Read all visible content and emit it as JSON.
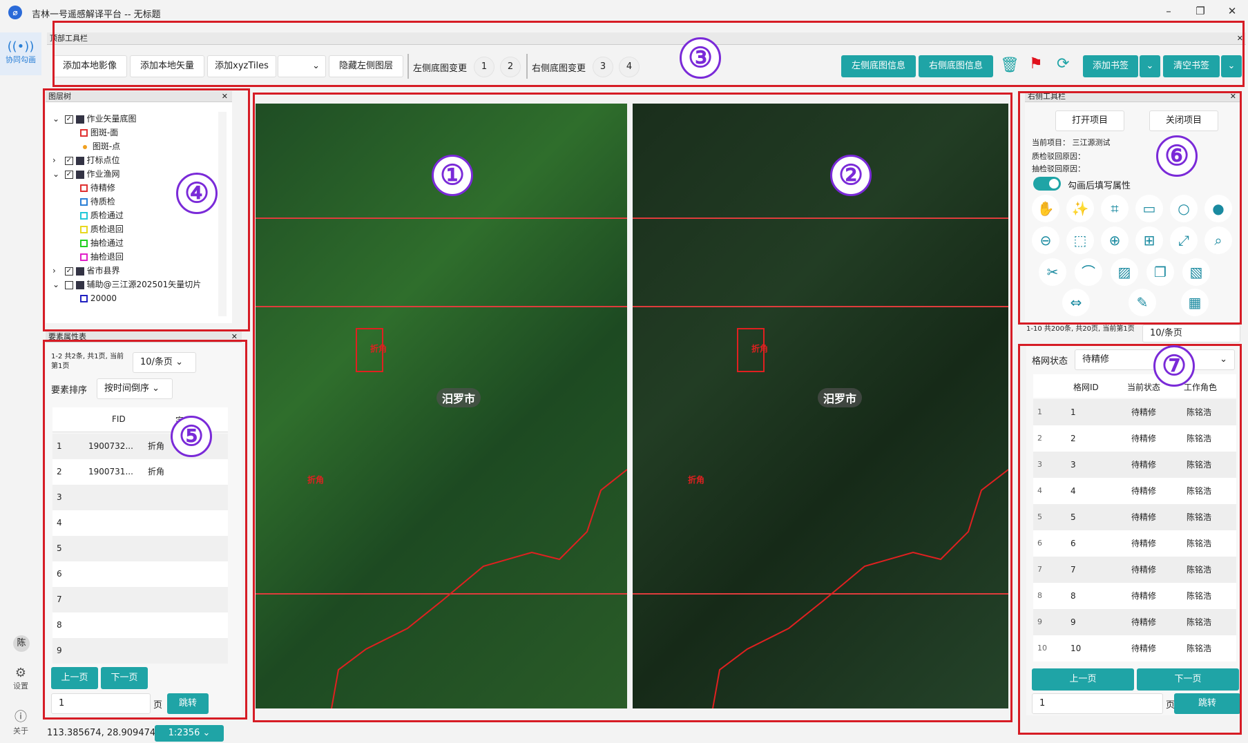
{
  "app": {
    "title": "吉林一号遥感解译平台 -- 无标题",
    "logo_icon": "app-logo-icon"
  },
  "window": {
    "minimize": "–",
    "maximize": "❐",
    "close": "✕"
  },
  "nav": {
    "collab": "协同勾画",
    "settings": "设置",
    "about": "关于",
    "avatar": "陈"
  },
  "toolbar": {
    "header": "顶部工具栏",
    "close": "✕",
    "add_image": "添加本地影像",
    "add_vector": "添加本地矢量",
    "add_xyz": "添加xyzTiles",
    "hide_left": "隐藏左侧图层",
    "left_change": "左侧底图变更",
    "n1": "1",
    "n2": "2",
    "right_change": "右侧底图变更",
    "n3": "3",
    "n4": "4",
    "left_info": "左侧底图信息",
    "right_info": "右侧底图信息",
    "add_bookmark": "添加书签",
    "clear_bookmark": "清空书签"
  },
  "layer_tree": {
    "header": "图层树",
    "close": "✕",
    "items": [
      {
        "label": "作业矢量底图",
        "level": 0
      },
      {
        "label": "图斑-面",
        "level": 1
      },
      {
        "label": "图斑-点",
        "level": 1
      },
      {
        "label": "打标点位",
        "level": 0
      },
      {
        "label": "作业渔网",
        "level": 0
      },
      {
        "label": "待精修",
        "level": 1
      },
      {
        "label": "待质检",
        "level": 1
      },
      {
        "label": "质检通过",
        "level": 1
      },
      {
        "label": "质检退回",
        "level": 1
      },
      {
        "label": "抽检通过",
        "level": 1
      },
      {
        "label": "抽检退回",
        "level": 1
      },
      {
        "label": "省市县界",
        "level": 0
      },
      {
        "label": "辅助@三江源202501矢量切片",
        "level": 0
      },
      {
        "label": "20000",
        "level": 1
      }
    ],
    "colors": {
      "red": "#e03030",
      "orange": "#f0a020",
      "blue": "#2a7fd6",
      "cyan": "#20c8d8",
      "yellow": "#e8d820",
      "green": "#20d020",
      "magenta": "#e020c8",
      "navy": "#2020c0"
    }
  },
  "attr_table": {
    "header": "要素属性表",
    "close": "✕",
    "pageinfo": "1-2 共2条, 共1页, 当前第1页",
    "per_page": "10/条页",
    "sort_label": "要素排序",
    "sort_value": "按时间倒序",
    "col_fid": "FID",
    "col_field": "字段1",
    "rows": [
      {
        "n": "1",
        "fid": "1900732...",
        "f": "折角"
      },
      {
        "n": "2",
        "fid": "1900731...",
        "f": "折角"
      },
      {
        "n": "3",
        "fid": "",
        "f": ""
      },
      {
        "n": "4",
        "fid": "",
        "f": ""
      },
      {
        "n": "5",
        "fid": "",
        "f": ""
      },
      {
        "n": "6",
        "fid": "",
        "f": ""
      },
      {
        "n": "7",
        "fid": "",
        "f": ""
      },
      {
        "n": "8",
        "fid": "",
        "f": ""
      },
      {
        "n": "9",
        "fid": "",
        "f": ""
      }
    ],
    "prev": "上一页",
    "next": "下一页",
    "page_input": "1",
    "page_unit": "页",
    "jump": "跳转"
  },
  "status": {
    "coords": "113.385674, 28.909474",
    "scale": "1:2356"
  },
  "maps": {
    "left_label": "汨罗市",
    "right_label": "汨罗市",
    "marker": "折角"
  },
  "right_tools": {
    "header": "右侧工具栏",
    "close": "✕",
    "open_project": "打开项目",
    "close_project": "关闭项目",
    "current_project": "当前项目：  三江源测试",
    "qc_reason": "质检驳回原因：",
    "sample_reason": "抽检驳回原因：",
    "toggle_label": "勾画后填写属性"
  },
  "grid_table": {
    "pageinfo": "1-10 共200条, 共20页, 当前第1页",
    "per_page": "10/条页",
    "status_label": "格网状态",
    "status_value": "待精修",
    "col_id": "格网ID",
    "col_state": "当前状态",
    "col_role": "工作角色",
    "rows": [
      {
        "n": "1",
        "id": "1",
        "state": "待精修",
        "role": "陈铭浩"
      },
      {
        "n": "2",
        "id": "2",
        "state": "待精修",
        "role": "陈铭浩"
      },
      {
        "n": "3",
        "id": "3",
        "state": "待精修",
        "role": "陈铭浩"
      },
      {
        "n": "4",
        "id": "4",
        "state": "待精修",
        "role": "陈铭浩"
      },
      {
        "n": "5",
        "id": "5",
        "state": "待精修",
        "role": "陈铭浩"
      },
      {
        "n": "6",
        "id": "6",
        "state": "待精修",
        "role": "陈铭浩"
      },
      {
        "n": "7",
        "id": "7",
        "state": "待精修",
        "role": "陈铭浩"
      },
      {
        "n": "8",
        "id": "8",
        "state": "待精修",
        "role": "陈铭浩"
      },
      {
        "n": "9",
        "id": "9",
        "state": "待精修",
        "role": "陈铭浩"
      },
      {
        "n": "10",
        "id": "10",
        "state": "待精修",
        "role": "陈铭浩"
      }
    ],
    "prev": "上一页",
    "next": "下一页",
    "page_input": "1",
    "page_unit": "页",
    "jump": "跳转"
  },
  "annotations": {
    "c1": "①",
    "c2": "②",
    "c3": "③",
    "c4": "④",
    "c5": "⑤",
    "c6": "⑥",
    "c7": "⑦"
  }
}
